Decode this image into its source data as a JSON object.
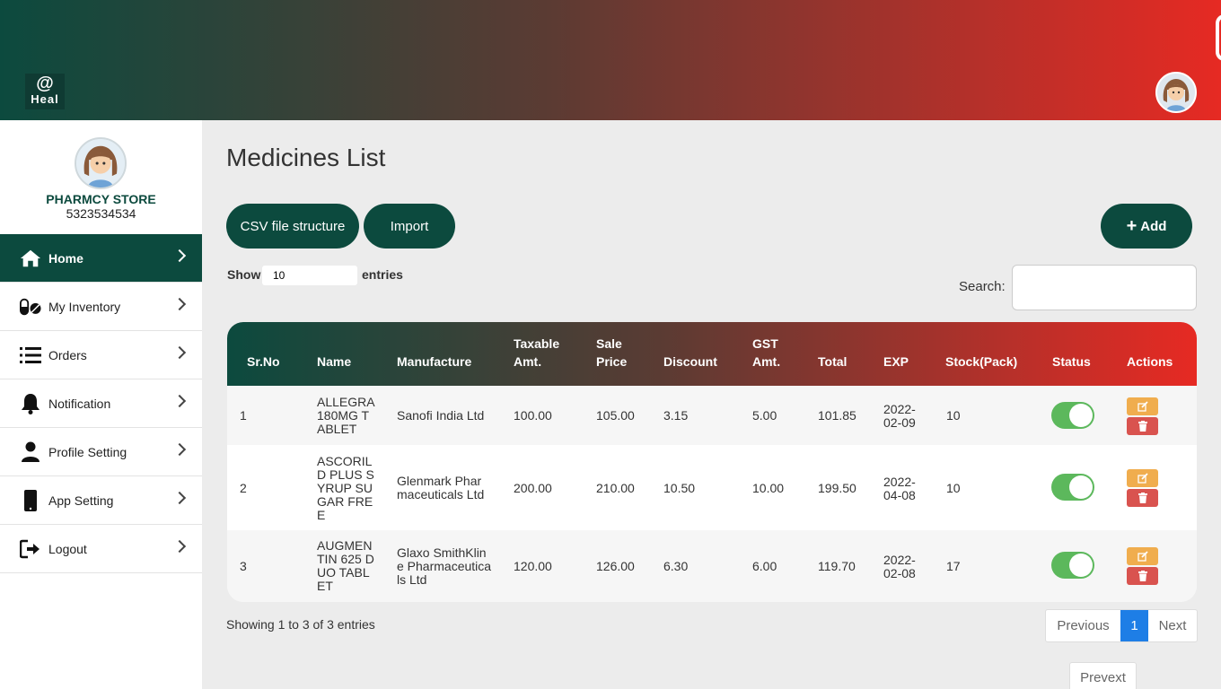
{
  "header": {
    "logo_symbol": "@",
    "logo_text": "Heal"
  },
  "sidebar": {
    "store_name": "PHARMCY STORE",
    "store_phone": "5323534534",
    "items": [
      {
        "label": "Home",
        "icon": "home-icon",
        "active": true
      },
      {
        "label": "My Inventory",
        "icon": "pills-icon"
      },
      {
        "label": "Orders",
        "icon": "list-icon"
      },
      {
        "label": "Notification",
        "icon": "bell-icon"
      },
      {
        "label": "Profile Setting",
        "icon": "user-icon"
      },
      {
        "label": "App Setting",
        "icon": "mobile-icon"
      },
      {
        "label": "Logout",
        "icon": "logout-icon"
      }
    ]
  },
  "main": {
    "title": "Medicines List",
    "csv_button": "CSV file structure",
    "import_button": "Import",
    "add_button": "Add",
    "show_label": "Show",
    "entries_value": "10",
    "entries_label": "entries",
    "search_label": "Search:",
    "search_value": ""
  },
  "table": {
    "headers": [
      "Sr.No",
      "Name",
      "Manufacture",
      "Taxable Amt.",
      "Sale Price",
      "Discount",
      "GST Amt.",
      "Total",
      "EXP",
      "Stock(Pack)",
      "Status",
      "Actions"
    ],
    "rows": [
      {
        "sr": "1",
        "name": "ALLEGRA 180MG TABLET",
        "manufacture": "Sanofi India Ltd",
        "taxable": "100.00",
        "sale": "105.00",
        "discount": "3.15",
        "gst": "5.00",
        "total": "101.85",
        "exp": "2022-02-09",
        "stock": "10",
        "status": true
      },
      {
        "sr": "2",
        "name": "ASCORIL D PLUS SYRUP SUGAR FREE",
        "manufacture": "Glenmark Pharmaceuticals Ltd",
        "taxable": "200.00",
        "sale": "210.00",
        "discount": "10.50",
        "gst": "10.00",
        "total": "199.50",
        "exp": "2022-04-08",
        "stock": "10",
        "status": true
      },
      {
        "sr": "3",
        "name": "AUGMENTIN 625 DUO TABLET",
        "manufacture": "Glaxo SmithKline Pharmaceuticals Ltd",
        "taxable": "120.00",
        "sale": "126.00",
        "discount": "6.30",
        "gst": "6.00",
        "total": "119.70",
        "exp": "2022-02-08",
        "stock": "17",
        "status": true
      }
    ]
  },
  "footer": {
    "showing_text": "Showing 1 to 3 of 3 entries",
    "previous": "Previous",
    "page": "1",
    "next": "Next",
    "prevext": "Prevext"
  },
  "colors": {
    "brand_dark": "#0c4a3e",
    "brand_red": "#e62a23",
    "toggle_on": "#5cb85c",
    "edit": "#f0ad4e",
    "delete": "#d9534f",
    "pager_active": "#1e7ee6"
  }
}
